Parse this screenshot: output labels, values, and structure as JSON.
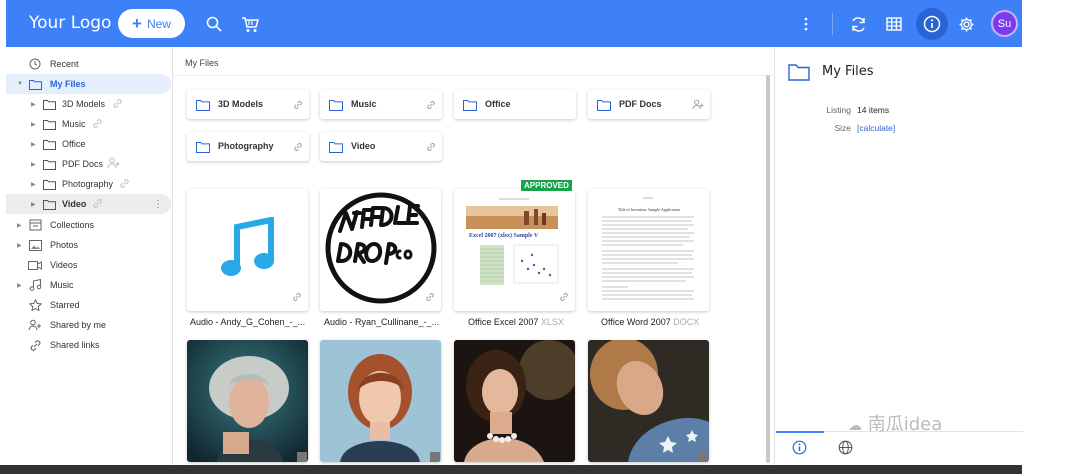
{
  "header": {
    "logo": "Your Logo",
    "new_label": "New",
    "avatar_initials": "Su"
  },
  "sidebar": {
    "items": [
      {
        "label": "Recent"
      },
      {
        "label": "My Files"
      },
      {
        "label": "3D Models"
      },
      {
        "label": "Music"
      },
      {
        "label": "Office"
      },
      {
        "label": "PDF Docs"
      },
      {
        "label": "Photography"
      },
      {
        "label": "Video"
      },
      {
        "label": "Collections"
      },
      {
        "label": "Photos"
      },
      {
        "label": "Videos"
      },
      {
        "label": "Music"
      },
      {
        "label": "Starred"
      },
      {
        "label": "Shared by me"
      },
      {
        "label": "Shared links"
      }
    ]
  },
  "main": {
    "breadcrumb": "My Files",
    "folders": [
      "3D Models",
      "Music",
      "Office",
      "PDF Docs",
      "Photography",
      "Video"
    ],
    "files": [
      {
        "name": "Audio - Andy_G_Cohen_-_...",
        "ext": ""
      },
      {
        "name": "Audio - Ryan_Cullinane_-_...",
        "ext": ""
      },
      {
        "name": "Office Excel 2007",
        "ext": "XLSX"
      },
      {
        "name": "Office Word 2007",
        "ext": "DOCX"
      }
    ],
    "approved_label": "APPROVED",
    "excel_preview_title": "Excel 2007 (xlsx) Sample V",
    "word_preview_title": "Title of Invention: Sample Application",
    "logo_text": "NEEDLE DROP CO"
  },
  "details": {
    "title": "My Files",
    "listing_key": "Listing",
    "listing_value": "14 items",
    "size_key": "Size",
    "size_value": "[calculate]"
  },
  "watermark": "南瓜idea",
  "colors": {
    "primary": "#3d80f7",
    "active_bg": "#e4eefd",
    "avatar": "#7c3aed",
    "approved": "#16a34a",
    "music_note": "#29a8e8"
  }
}
